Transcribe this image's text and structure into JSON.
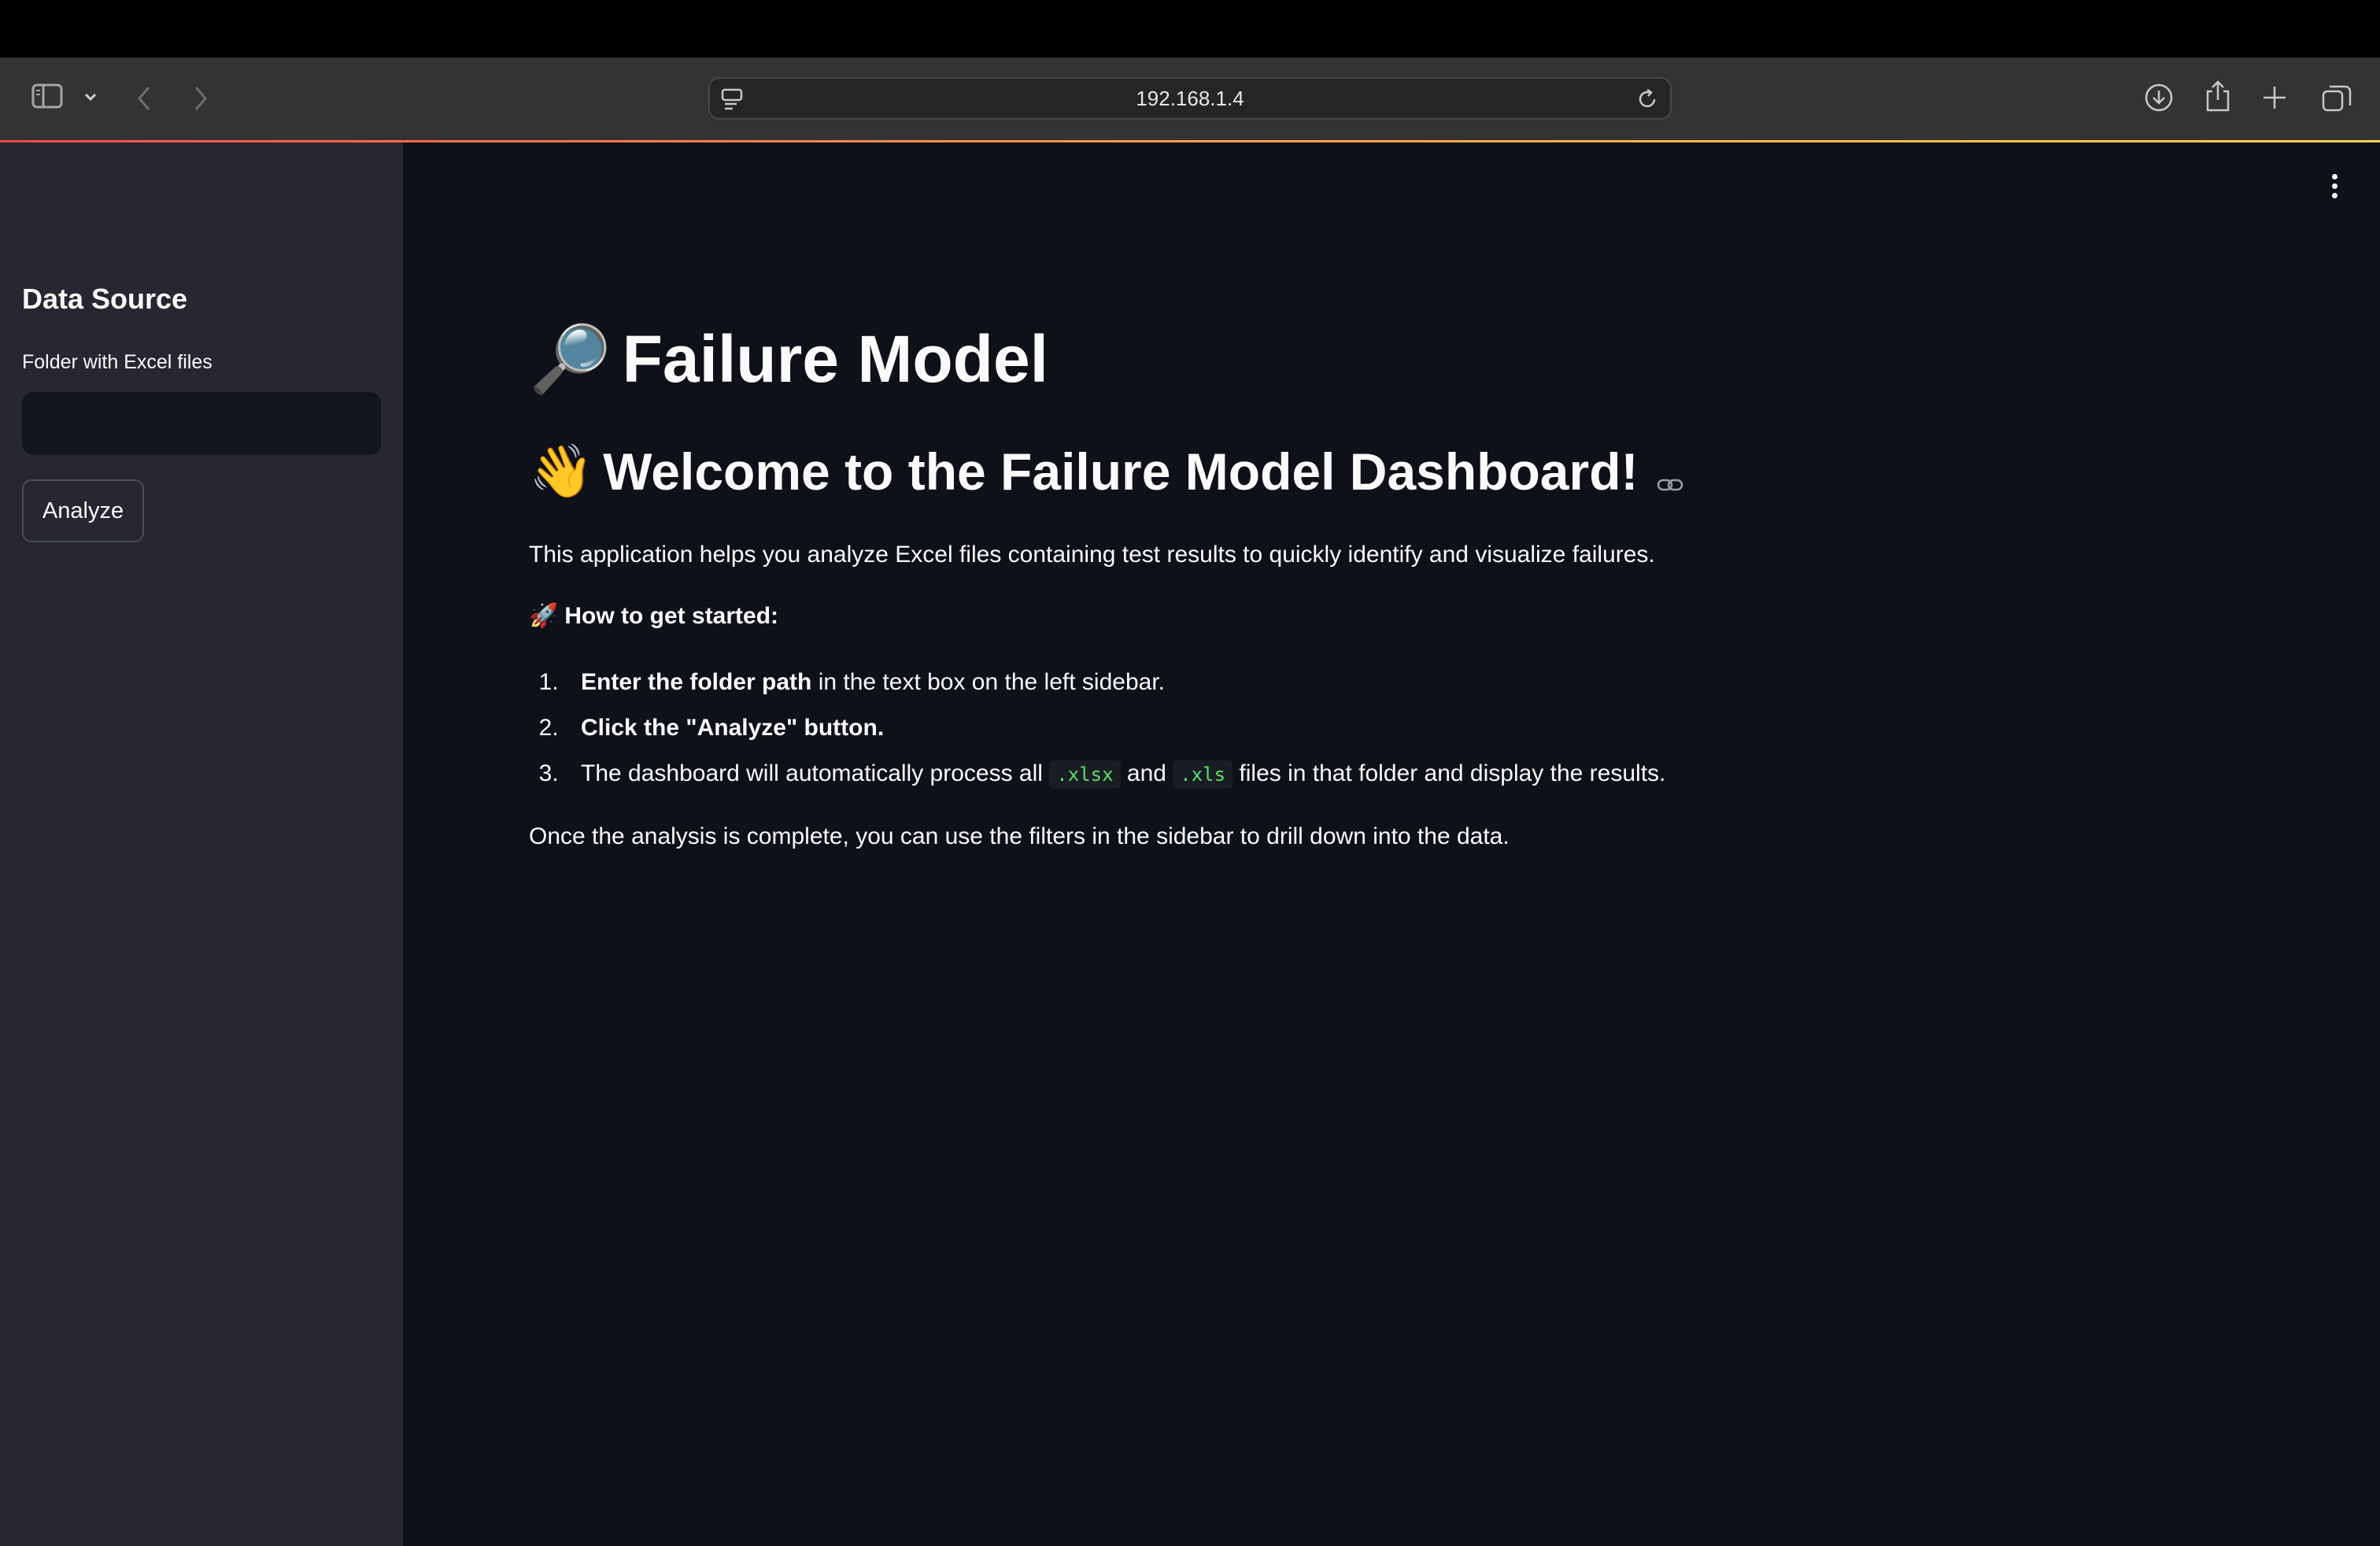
{
  "browser": {
    "url": "192.168.1.4"
  },
  "sidebar": {
    "title": "Data Source",
    "folder_label": "Folder with Excel files",
    "folder_value": "",
    "analyze_label": "Analyze"
  },
  "main": {
    "title_emoji": "🔎",
    "title": "Failure Model",
    "welcome_emoji": "👋",
    "welcome": "Welcome to the Failure Model Dashboard!",
    "intro": "This application helps you analyze Excel files containing test results to quickly identify and visualize failures.",
    "howto_emoji": "🚀",
    "howto": "How to get started:",
    "steps": [
      {
        "bold": "Enter the folder path",
        "rest": " in the text box on the left sidebar."
      },
      {
        "bold": "Click the \"Analyze\" button.",
        "rest": ""
      },
      {
        "pre": "The dashboard will automatically process all ",
        "code1": ".xlsx",
        "mid": " and ",
        "code2": ".xls",
        "post": " files in that folder and display the results."
      }
    ],
    "outro": "Once the analysis is complete, you can use the filters in the sidebar to drill down into the data."
  },
  "colors": {
    "sidebar_bg": "#262730",
    "main_bg": "#0e1117",
    "accent": "#ff4b4b",
    "code": "#5ae06a"
  }
}
